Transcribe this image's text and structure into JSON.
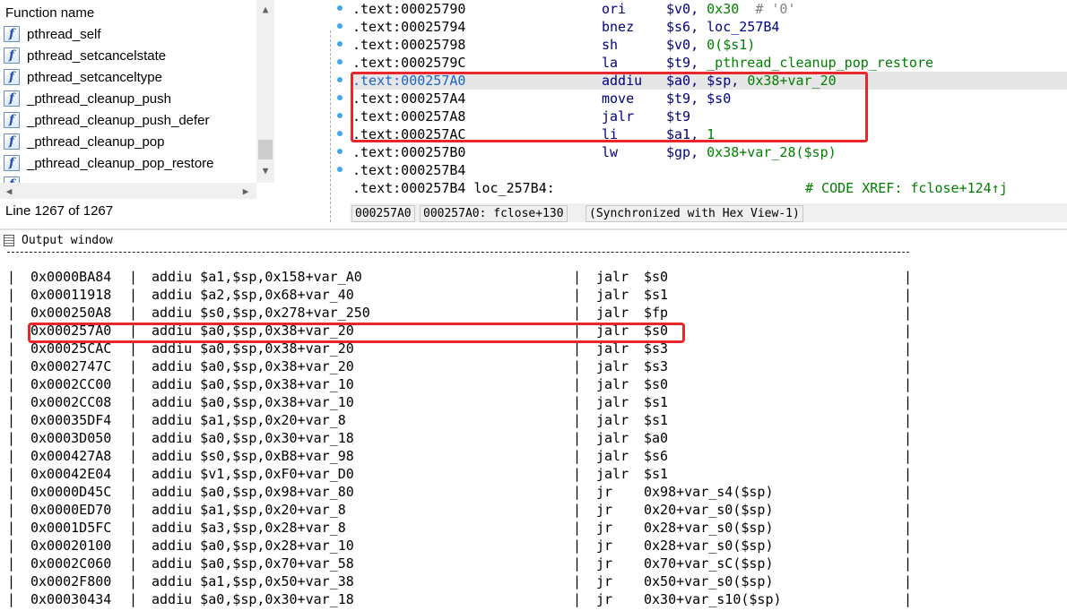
{
  "function_panel": {
    "header": "Function name",
    "items": [
      {
        "icon": "function-icon",
        "label": "pthread_self"
      },
      {
        "icon": "function-icon",
        "label": "pthread_setcancelstate"
      },
      {
        "icon": "function-icon",
        "label": "pthread_setcanceltype"
      },
      {
        "icon": "function-icon",
        "label": "_pthread_cleanup_push"
      },
      {
        "icon": "function-icon",
        "label": "_pthread_cleanup_push_defer"
      },
      {
        "icon": "function-icon",
        "label": "_pthread_cleanup_pop"
      },
      {
        "icon": "function-icon",
        "label": "_pthread_cleanup_pop_restore"
      }
    ],
    "status": "Line 1267 of 1267"
  },
  "disassembly": {
    "lines": [
      {
        "addr": ".text:00025790",
        "mnem": "ori",
        "ops": "$v0, ",
        "imm": "0x30",
        "comment": "  # '0'"
      },
      {
        "addr": ".text:00025794",
        "mnem": "bnez",
        "ops": "$s6, loc_257B4",
        "imm": "",
        "comment": ""
      },
      {
        "addr": ".text:00025798",
        "mnem": "sh",
        "ops": "$v0, ",
        "imm": "0($s1)",
        "comment": ""
      },
      {
        "addr": ".text:0002579C",
        "mnem": "la",
        "ops": "$t9, ",
        "imm": "_pthread_cleanup_pop_restore",
        "comment": ""
      },
      {
        "addr": ".text:000257A0",
        "mnem": "addiu",
        "ops": "$a0, $sp, ",
        "imm": "0x38+var_20",
        "comment": ""
      },
      {
        "addr": ".text:000257A4",
        "mnem": "move",
        "ops": "$t9, $s0",
        "imm": "",
        "comment": ""
      },
      {
        "addr": ".text:000257A8",
        "mnem": "jalr",
        "ops": "$t9",
        "imm": "",
        "comment": ""
      },
      {
        "addr": ".text:000257AC",
        "mnem": "li",
        "ops": "$a1, ",
        "imm": "1",
        "comment": ""
      },
      {
        "addr": ".text:000257B0",
        "mnem": "lw",
        "ops": "$gp, ",
        "imm": "0x38+var_28($sp)",
        "comment": ""
      },
      {
        "addr": ".text:000257B4",
        "mnem": "",
        "ops": "",
        "imm": "",
        "comment": ""
      }
    ],
    "label_line": {
      "addr": ".text:000257B4 loc_257B4:",
      "xref": "# CODE XREF: fclose+124↑j"
    },
    "status": {
      "offset": "000257A0",
      "location": "000257A0: fclose+130",
      "sync": "(Synchronized with Hex View-1)"
    }
  },
  "output": {
    "title": "Output window",
    "rows": [
      {
        "addr": "0x0000BA84",
        "insn": "addiu $a1,$sp,0x158+var_A0",
        "jmp": "jalr",
        "target": "$s0"
      },
      {
        "addr": "0x00011918",
        "insn": "addiu $a2,$sp,0x68+var_40",
        "jmp": "jalr",
        "target": "$s1"
      },
      {
        "addr": "0x000250A8",
        "insn": "addiu $s0,$sp,0x278+var_250",
        "jmp": "jalr",
        "target": "$fp"
      },
      {
        "addr": "0x000257A0",
        "insn": "addiu $a0,$sp,0x38+var_20",
        "jmp": "jalr",
        "target": "$s0"
      },
      {
        "addr": "0x00025CAC",
        "insn": "addiu $a0,$sp,0x38+var_20",
        "jmp": "jalr",
        "target": "$s3"
      },
      {
        "addr": "0x0002747C",
        "insn": "addiu $a0,$sp,0x38+var_20",
        "jmp": "jalr",
        "target": "$s3"
      },
      {
        "addr": "0x0002CC00",
        "insn": "addiu $a0,$sp,0x38+var_10",
        "jmp": "jalr",
        "target": "$s0"
      },
      {
        "addr": "0x0002CC08",
        "insn": "addiu $a0,$sp,0x38+var_10",
        "jmp": "jalr",
        "target": "$s1"
      },
      {
        "addr": "0x00035DF4",
        "insn": "addiu $a1,$sp,0x20+var_8",
        "jmp": "jalr",
        "target": "$s1"
      },
      {
        "addr": "0x0003D050",
        "insn": "addiu $a0,$sp,0x30+var_18",
        "jmp": "jalr",
        "target": "$a0"
      },
      {
        "addr": "0x000427A8",
        "insn": "addiu $s0,$sp,0xB8+var_98",
        "jmp": "jalr",
        "target": "$s6"
      },
      {
        "addr": "0x00042E04",
        "insn": "addiu $v1,$sp,0xF0+var_D0",
        "jmp": "jalr",
        "target": "$s1"
      },
      {
        "addr": "0x0000D45C",
        "insn": "addiu $a0,$sp,0x98+var_80",
        "jmp": "jr",
        "target": "0x98+var_s4($sp)"
      },
      {
        "addr": "0x0000ED70",
        "insn": "addiu $a1,$sp,0x20+var_8",
        "jmp": "jr",
        "target": "0x20+var_s0($sp)"
      },
      {
        "addr": "0x0001D5FC",
        "insn": "addiu $a3,$sp,0x28+var_8",
        "jmp": "jr",
        "target": "0x28+var_s0($sp)"
      },
      {
        "addr": "0x00020100",
        "insn": "addiu $a0,$sp,0x28+var_10",
        "jmp": "jr",
        "target": "0x28+var_s0($sp)"
      },
      {
        "addr": "0x0002C060",
        "insn": "addiu $a0,$sp,0x70+var_58",
        "jmp": "jr",
        "target": "0x70+var_sC($sp)"
      },
      {
        "addr": "0x0002F800",
        "insn": "addiu $a1,$sp,0x50+var_38",
        "jmp": "jr",
        "target": "0x50+var_s0($sp)"
      },
      {
        "addr": "0x00030434",
        "insn": "addiu $a0,$sp,0x30+var_18",
        "jmp": "jr",
        "target": "0x30+var_s10($sp)"
      }
    ]
  },
  "colors": {
    "highlight_box": "#e8262b",
    "address_current": "#1b64c8",
    "immediate": "#007f00",
    "mnemonic": "#000080"
  }
}
